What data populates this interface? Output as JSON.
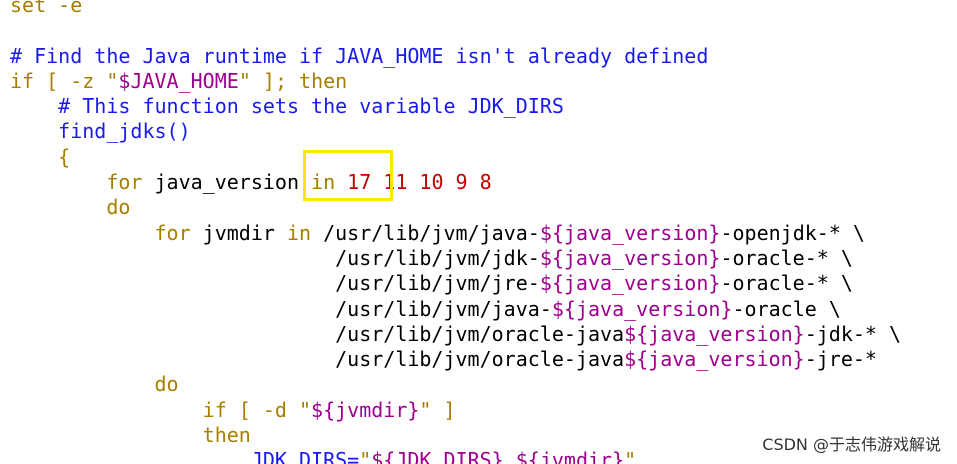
{
  "colors": {
    "keyword": "#a67f00",
    "comment": "#1a1af0",
    "string": "#a0008f",
    "number": "#c40000",
    "plain": "#000000",
    "highlight_box": "#ffe600"
  },
  "code_lines": [
    [
      {
        "t": "set -e",
        "c": "kw"
      }
    ],
    [],
    [
      {
        "t": "# Find the Java runtime if JAVA_HOME isn't already defined",
        "c": "cm"
      }
    ],
    [
      {
        "t": "if",
        "c": "kw"
      },
      {
        "t": " [ -z ",
        "c": "kw"
      },
      {
        "t": "\"",
        "c": "kw"
      },
      {
        "t": "$JAVA_HOME",
        "c": "str"
      },
      {
        "t": "\"",
        "c": "kw"
      },
      {
        "t": " ]; ",
        "c": "kw"
      },
      {
        "t": "then",
        "c": "kw"
      }
    ],
    [
      {
        "t": "    ",
        "c": "pl"
      },
      {
        "t": "# This function sets the variable JDK_DIRS",
        "c": "cm"
      }
    ],
    [
      {
        "t": "    ",
        "c": "pl"
      },
      {
        "t": "find_jdks()",
        "c": "cm"
      }
    ],
    [
      {
        "t": "    ",
        "c": "pl"
      },
      {
        "t": "{",
        "c": "kw"
      }
    ],
    [
      {
        "t": "        ",
        "c": "pl"
      },
      {
        "t": "for",
        "c": "kw"
      },
      {
        "t": " java_version ",
        "c": "pl"
      },
      {
        "t": "in",
        "c": "kw"
      },
      {
        "t": " ",
        "c": "pl"
      },
      {
        "t": "17 11 10 9 8",
        "c": "num"
      }
    ],
    [
      {
        "t": "        ",
        "c": "pl"
      },
      {
        "t": "do",
        "c": "kw"
      }
    ],
    [
      {
        "t": "            ",
        "c": "pl"
      },
      {
        "t": "for",
        "c": "kw"
      },
      {
        "t": " jvmdir ",
        "c": "pl"
      },
      {
        "t": "in",
        "c": "kw"
      },
      {
        "t": " /usr/lib/jvm/java-",
        "c": "pl"
      },
      {
        "t": "${java_version}",
        "c": "str"
      },
      {
        "t": "-openjdk-* \\",
        "c": "pl"
      }
    ],
    [
      {
        "t": "                           /usr/lib/jvm/jdk-",
        "c": "pl"
      },
      {
        "t": "${java_version}",
        "c": "str"
      },
      {
        "t": "-oracle-* \\",
        "c": "pl"
      }
    ],
    [
      {
        "t": "                           /usr/lib/jvm/jre-",
        "c": "pl"
      },
      {
        "t": "${java_version}",
        "c": "str"
      },
      {
        "t": "-oracle-* \\",
        "c": "pl"
      }
    ],
    [
      {
        "t": "                           /usr/lib/jvm/java-",
        "c": "pl"
      },
      {
        "t": "${java_version}",
        "c": "str"
      },
      {
        "t": "-oracle \\",
        "c": "pl"
      }
    ],
    [
      {
        "t": "                           /usr/lib/jvm/oracle-java",
        "c": "pl"
      },
      {
        "t": "${java_version}",
        "c": "str"
      },
      {
        "t": "-jdk-* \\",
        "c": "pl"
      }
    ],
    [
      {
        "t": "                           /usr/lib/jvm/oracle-java",
        "c": "pl"
      },
      {
        "t": "${java_version}",
        "c": "str"
      },
      {
        "t": "-jre-*",
        "c": "pl"
      }
    ],
    [
      {
        "t": "            ",
        "c": "pl"
      },
      {
        "t": "do",
        "c": "kw"
      }
    ],
    [
      {
        "t": "                ",
        "c": "pl"
      },
      {
        "t": "if",
        "c": "kw"
      },
      {
        "t": " [ -d ",
        "c": "kw"
      },
      {
        "t": "\"",
        "c": "kw"
      },
      {
        "t": "${jvmdir}",
        "c": "str"
      },
      {
        "t": "\"",
        "c": "kw"
      },
      {
        "t": " ]",
        "c": "kw"
      }
    ],
    [
      {
        "t": "                ",
        "c": "pl"
      },
      {
        "t": "then",
        "c": "kw"
      }
    ],
    [
      {
        "t": "                    ",
        "c": "pl"
      },
      {
        "t": "JDK_DIRS=",
        "c": "cm"
      },
      {
        "t": "\"",
        "c": "kw"
      },
      {
        "t": "${JDK_DIRS} ${jvmdir}",
        "c": "str"
      },
      {
        "t": "\"",
        "c": "kw"
      }
    ]
  ],
  "watermark": "CSDN @于志伟游戏解说"
}
